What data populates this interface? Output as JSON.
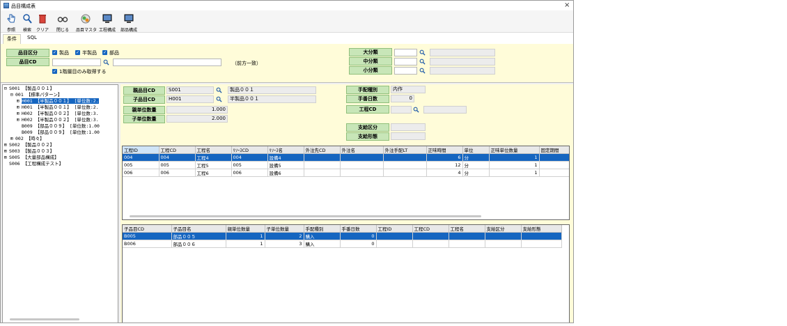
{
  "window": {
    "title": "品目構成表",
    "close_glyph": "×"
  },
  "toolbar": {
    "buttons": [
      {
        "label": "参照",
        "icon": "hand-pointer-icon"
      },
      {
        "label": "検索",
        "icon": "search-icon"
      },
      {
        "label": "クリア",
        "icon": "trash-icon"
      },
      {
        "label": "閉じる",
        "icon": "binoculars-icon"
      },
      {
        "label": "品目マスタ",
        "icon": "item-master-icon"
      },
      {
        "label": "工程構成",
        "icon": "monitor-icon"
      },
      {
        "label": "部品構成",
        "icon": "monitor-icon"
      }
    ]
  },
  "tabs": [
    {
      "label": "条件"
    },
    {
      "label": "SQL"
    }
  ],
  "conditions": {
    "item_type_label": "品目区分",
    "item_cd_label": "品目CD",
    "checks": [
      {
        "label": "製品"
      },
      {
        "label": "半製品"
      },
      {
        "label": "部品"
      }
    ],
    "first_level_only_label": "1階層目のみ取得する",
    "prefix_match": "（前方一致）",
    "large_class_label": "大分類",
    "medium_class_label": "中分類",
    "small_class_label": "小分類"
  },
  "tree": [
    {
      "text": "S001 【製品００１】",
      "indent": 0,
      "expander": "⊟"
    },
    {
      "text": "001 【標準パターン】",
      "indent": 1,
      "expander": "⊟"
    },
    {
      "text": "H001 【半製品００１】 [単位数:2.",
      "indent": 2,
      "expander": "⊞",
      "selected": true
    },
    {
      "text": "H001 【半製品００１】 [単位数:2.",
      "indent": 2,
      "expander": "⊞"
    },
    {
      "text": "H002 【半製品００２】 [単位数:3.",
      "indent": 2,
      "expander": "⊞"
    },
    {
      "text": "H002 【半製品００２】 [単位数:3.",
      "indent": 2,
      "expander": "⊞"
    },
    {
      "text": "B009 【部品００９】 [単位数:1.00",
      "indent": 2,
      "expander": ""
    },
    {
      "text": "B009 【部品００９】 [単位数:1.00",
      "indent": 2,
      "expander": ""
    },
    {
      "text": "002 【時々】",
      "indent": 1,
      "expander": "⊞"
    },
    {
      "text": "S002 【製品００２】",
      "indent": 0,
      "expander": "⊞"
    },
    {
      "text": "S003 【製品００３】",
      "indent": 0,
      "expander": "⊞"
    },
    {
      "text": "S005 【大量部品構成】",
      "indent": 0,
      "expander": "⊞"
    },
    {
      "text": "S006 【工程構成テスト】",
      "indent": 0,
      "expander": ""
    }
  ],
  "detail": {
    "parent_item_cd_label": "親品目CD",
    "parent_item_cd": "S001",
    "parent_item_name": "製品００１",
    "child_item_cd_label": "子品目CD",
    "child_item_cd": "H001",
    "child_item_name": "半製品００１",
    "parent_unit_qty_label": "親単位数量",
    "parent_unit_qty": "1.000",
    "child_unit_qty_label": "子単位数量",
    "child_unit_qty": "2.000",
    "arrangement_type_label": "手配種別",
    "arrangement_type": "内作",
    "order_days_label": "手番日数",
    "order_days": "0",
    "process_cd_label": "工程CD",
    "supply_type_label": "支給区分",
    "supply_form_label": "支給形態"
  },
  "process_table": {
    "headers": [
      "工程ID",
      "工程CD",
      "工程名",
      "ﾘｿｰｽCD",
      "ﾘｿｰｽ名",
      "外注先CD",
      "外注名",
      "外注手配LT",
      "正味時間",
      "単位",
      "正味単位数量",
      "固定期間"
    ],
    "rows": [
      [
        "004",
        "004",
        "工程4",
        "004",
        "設備4",
        "",
        "",
        "",
        "6",
        "分",
        "1",
        ""
      ],
      [
        "005",
        "005",
        "工程5",
        "005",
        "設備5",
        "",
        "",
        "",
        "12",
        "分",
        "1",
        ""
      ],
      [
        "006",
        "006",
        "工程6",
        "006",
        "設備6",
        "",
        "",
        "",
        "4",
        "分",
        "1",
        ""
      ]
    ]
  },
  "parts_table": {
    "headers": [
      "子品目CD",
      "子品目名",
      "親単位数量",
      "子単位数量",
      "手配種別",
      "手番日数",
      "工程ID",
      "工程CD",
      "工程名",
      "支給区分",
      "支給形態"
    ],
    "rows": [
      [
        "B005",
        "部品００５",
        "1",
        "2",
        "購入",
        "0",
        "",
        "",
        "",
        "",
        ""
      ],
      [
        "B006",
        "部品００６",
        "1",
        "3",
        "購入",
        "0",
        "",
        "",
        "",
        "",
        ""
      ]
    ]
  }
}
